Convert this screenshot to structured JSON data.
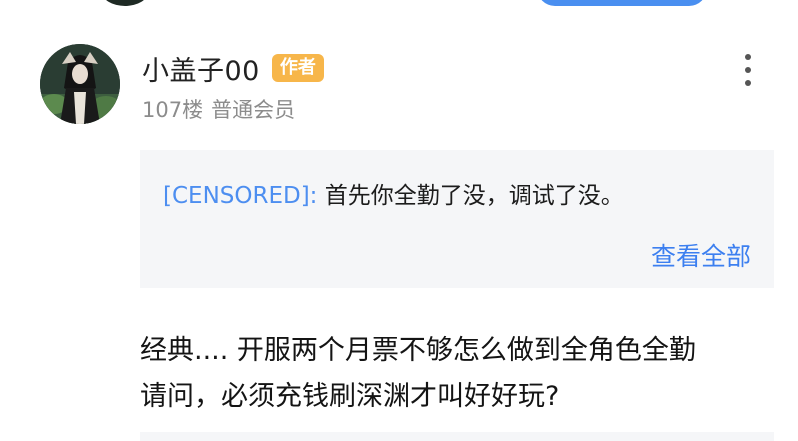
{
  "post": {
    "username": "小盖子00",
    "author_badge": "作者",
    "floor": "107楼",
    "member_level": "普通会员",
    "more_icon": "more-vertical-icon",
    "quote": {
      "author": "[CENSORED]:",
      "text": "首先你全勤了没，调试了没。",
      "view_all": "查看全部"
    },
    "body_lines": [
      "经典....  开服两个月票不够怎么做到全角色全勤",
      "请问，必须充钱刷深渊才叫好好玩?"
    ]
  },
  "colors": {
    "badge": "#f7b64a",
    "link_blue": "#3c7ff0",
    "quote_bg": "#f5f6f8",
    "meta_gray": "#8c8c8c"
  }
}
